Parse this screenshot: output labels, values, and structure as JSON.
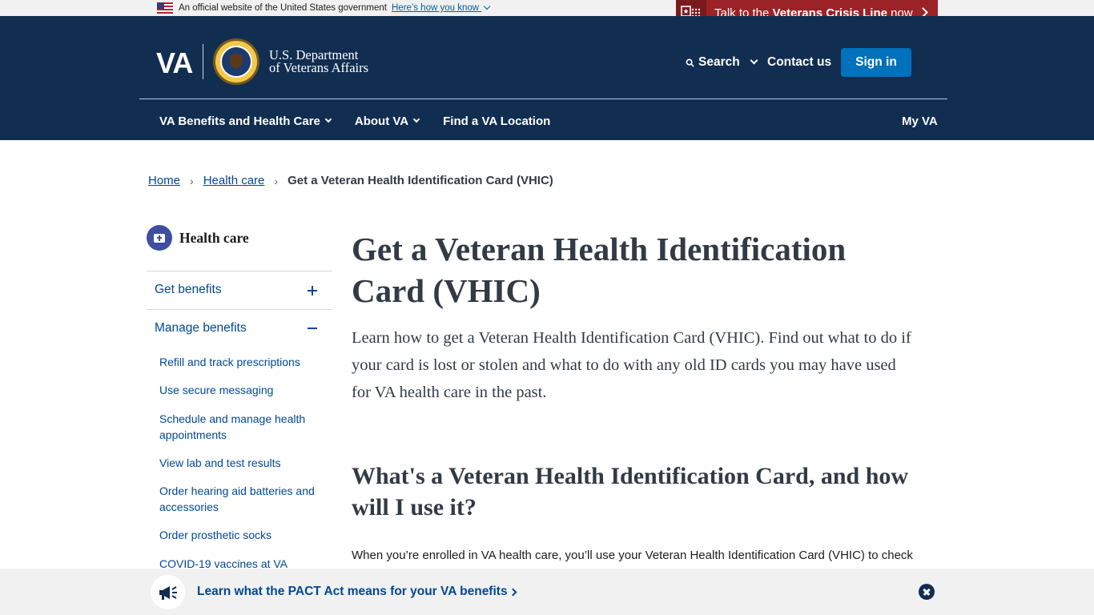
{
  "official_banner": {
    "text": "An official website of the United States government",
    "link": "Here’s how you know"
  },
  "crisis_line": {
    "prefix": "Talk to the ",
    "bold": "Veterans Crisis Line",
    "suffix": " now"
  },
  "header": {
    "logo_text": "VA",
    "dept_line1": "U.S. Department",
    "dept_line2": "of Veterans Affairs",
    "search_label": "Search",
    "contact_label": "Contact us",
    "signin_label": "Sign in"
  },
  "nav": {
    "items": [
      {
        "label": "VA Benefits and Health Care",
        "has_dropdown": true
      },
      {
        "label": "About VA",
        "has_dropdown": true
      },
      {
        "label": "Find a VA Location",
        "has_dropdown": false
      }
    ],
    "my_va": "My VA"
  },
  "breadcrumb": {
    "items": [
      "Home",
      "Health care"
    ],
    "current": "Get a Veteran Health Identification Card (VHIC)",
    "separator": "›"
  },
  "sidebar": {
    "title": "Health care",
    "sections": [
      {
        "label": "Get benefits",
        "state": "collapsed"
      },
      {
        "label": "Manage benefits",
        "state": "expanded"
      }
    ],
    "sub_items": [
      "Refill and track prescriptions",
      "Use secure messaging",
      "Schedule and manage health appointments",
      "View lab and test results",
      "Order hearing aid batteries and accessories",
      "Order prosthetic socks",
      "COVID-19 vaccines at VA"
    ]
  },
  "main": {
    "title": "Get a Veteran Health Identification Card (VHIC)",
    "lead": "Learn how to get a Veteran Health Identification Card (VHIC). Find out what to do if your card is lost or stolen and what to do with any old ID cards you may have used for VA health care in the past.",
    "h2": "What's a Veteran Health Identification Card, and how will I use it?",
    "body": "When you’re enrolled in VA health care, you’ll use your Veteran Health Identification Card (VHIC) to check"
  },
  "pact_banner": {
    "text": "Learn what the PACT Act means for your VA benefits"
  },
  "colors": {
    "header_bg": "#112e51",
    "crisis_red": "#9b2226",
    "signin_blue": "#0071bb",
    "link_blue": "#004795",
    "heading": "#323a45"
  }
}
